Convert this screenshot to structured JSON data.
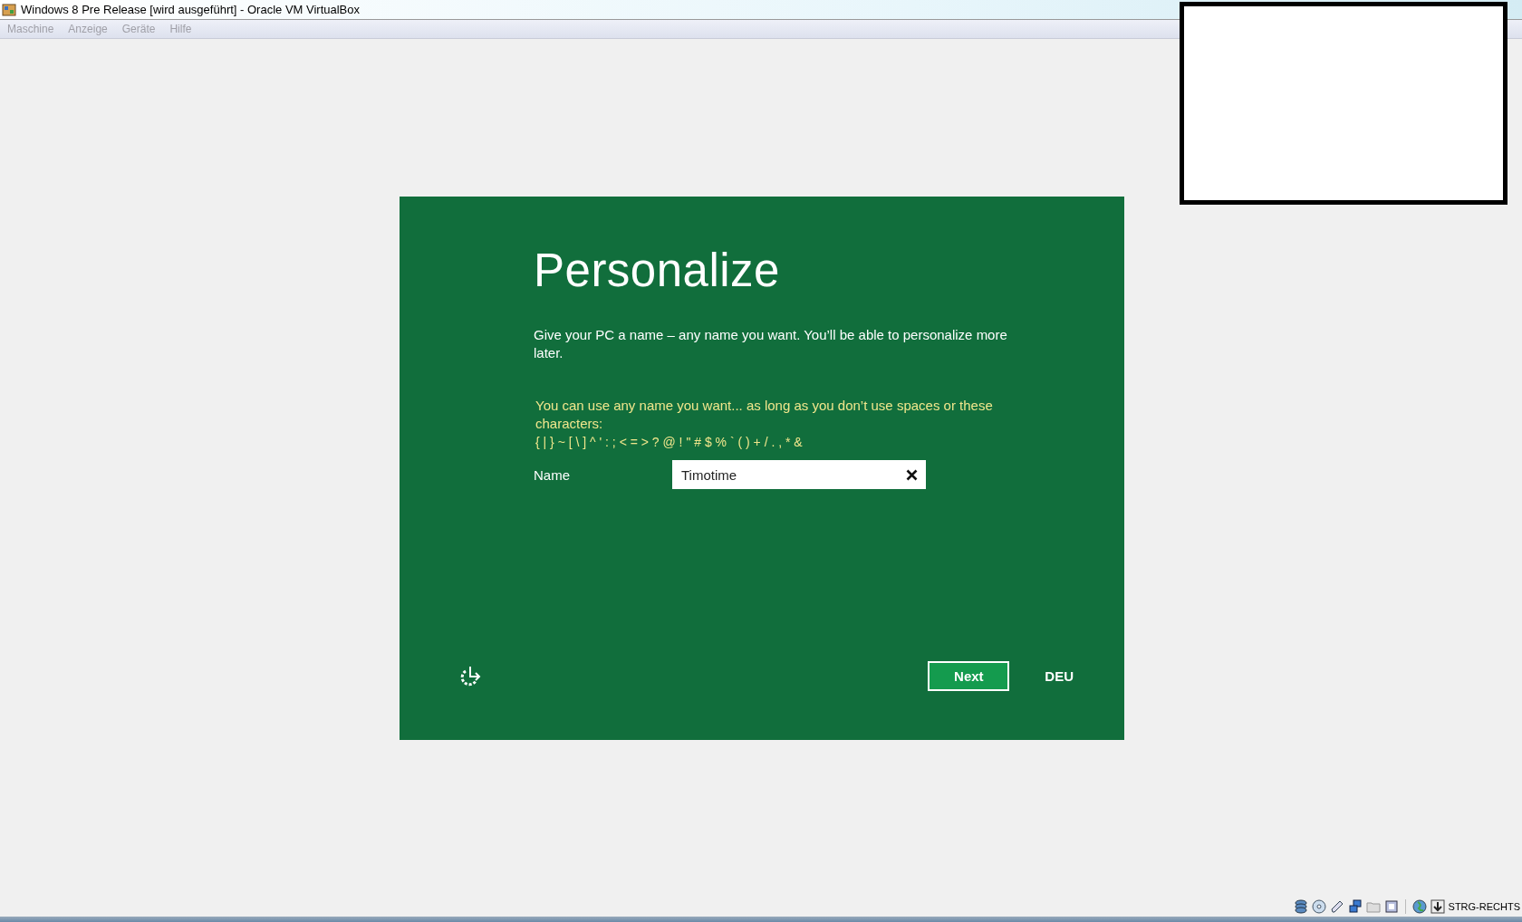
{
  "window": {
    "title": "Windows 8 Pre Release [wird ausgeführt] - Oracle VM VirtualBox"
  },
  "menu": [
    {
      "label": "Maschine",
      "disabled": true
    },
    {
      "label": "Anzeige",
      "disabled": true
    },
    {
      "label": "Geräte",
      "disabled": true
    },
    {
      "label": "Hilfe",
      "disabled": true
    }
  ],
  "setup": {
    "title": "Personalize",
    "description": "Give your PC a name – any name you want. You’ll be able to personalize more later.",
    "hint": "You can use any name you want... as long as you don’t use spaces or these characters:",
    "forbidden_characters": "{ | } ~ [ \\ ] ^ ' : ; < = > ? @ ! \" # $ % ` ( ) + / . , * &",
    "name_label": "Name",
    "name_value": "Timotime",
    "next_button": "Next",
    "language": "DEU"
  },
  "status_bar": {
    "host_key": "STRG-RECHTS"
  }
}
